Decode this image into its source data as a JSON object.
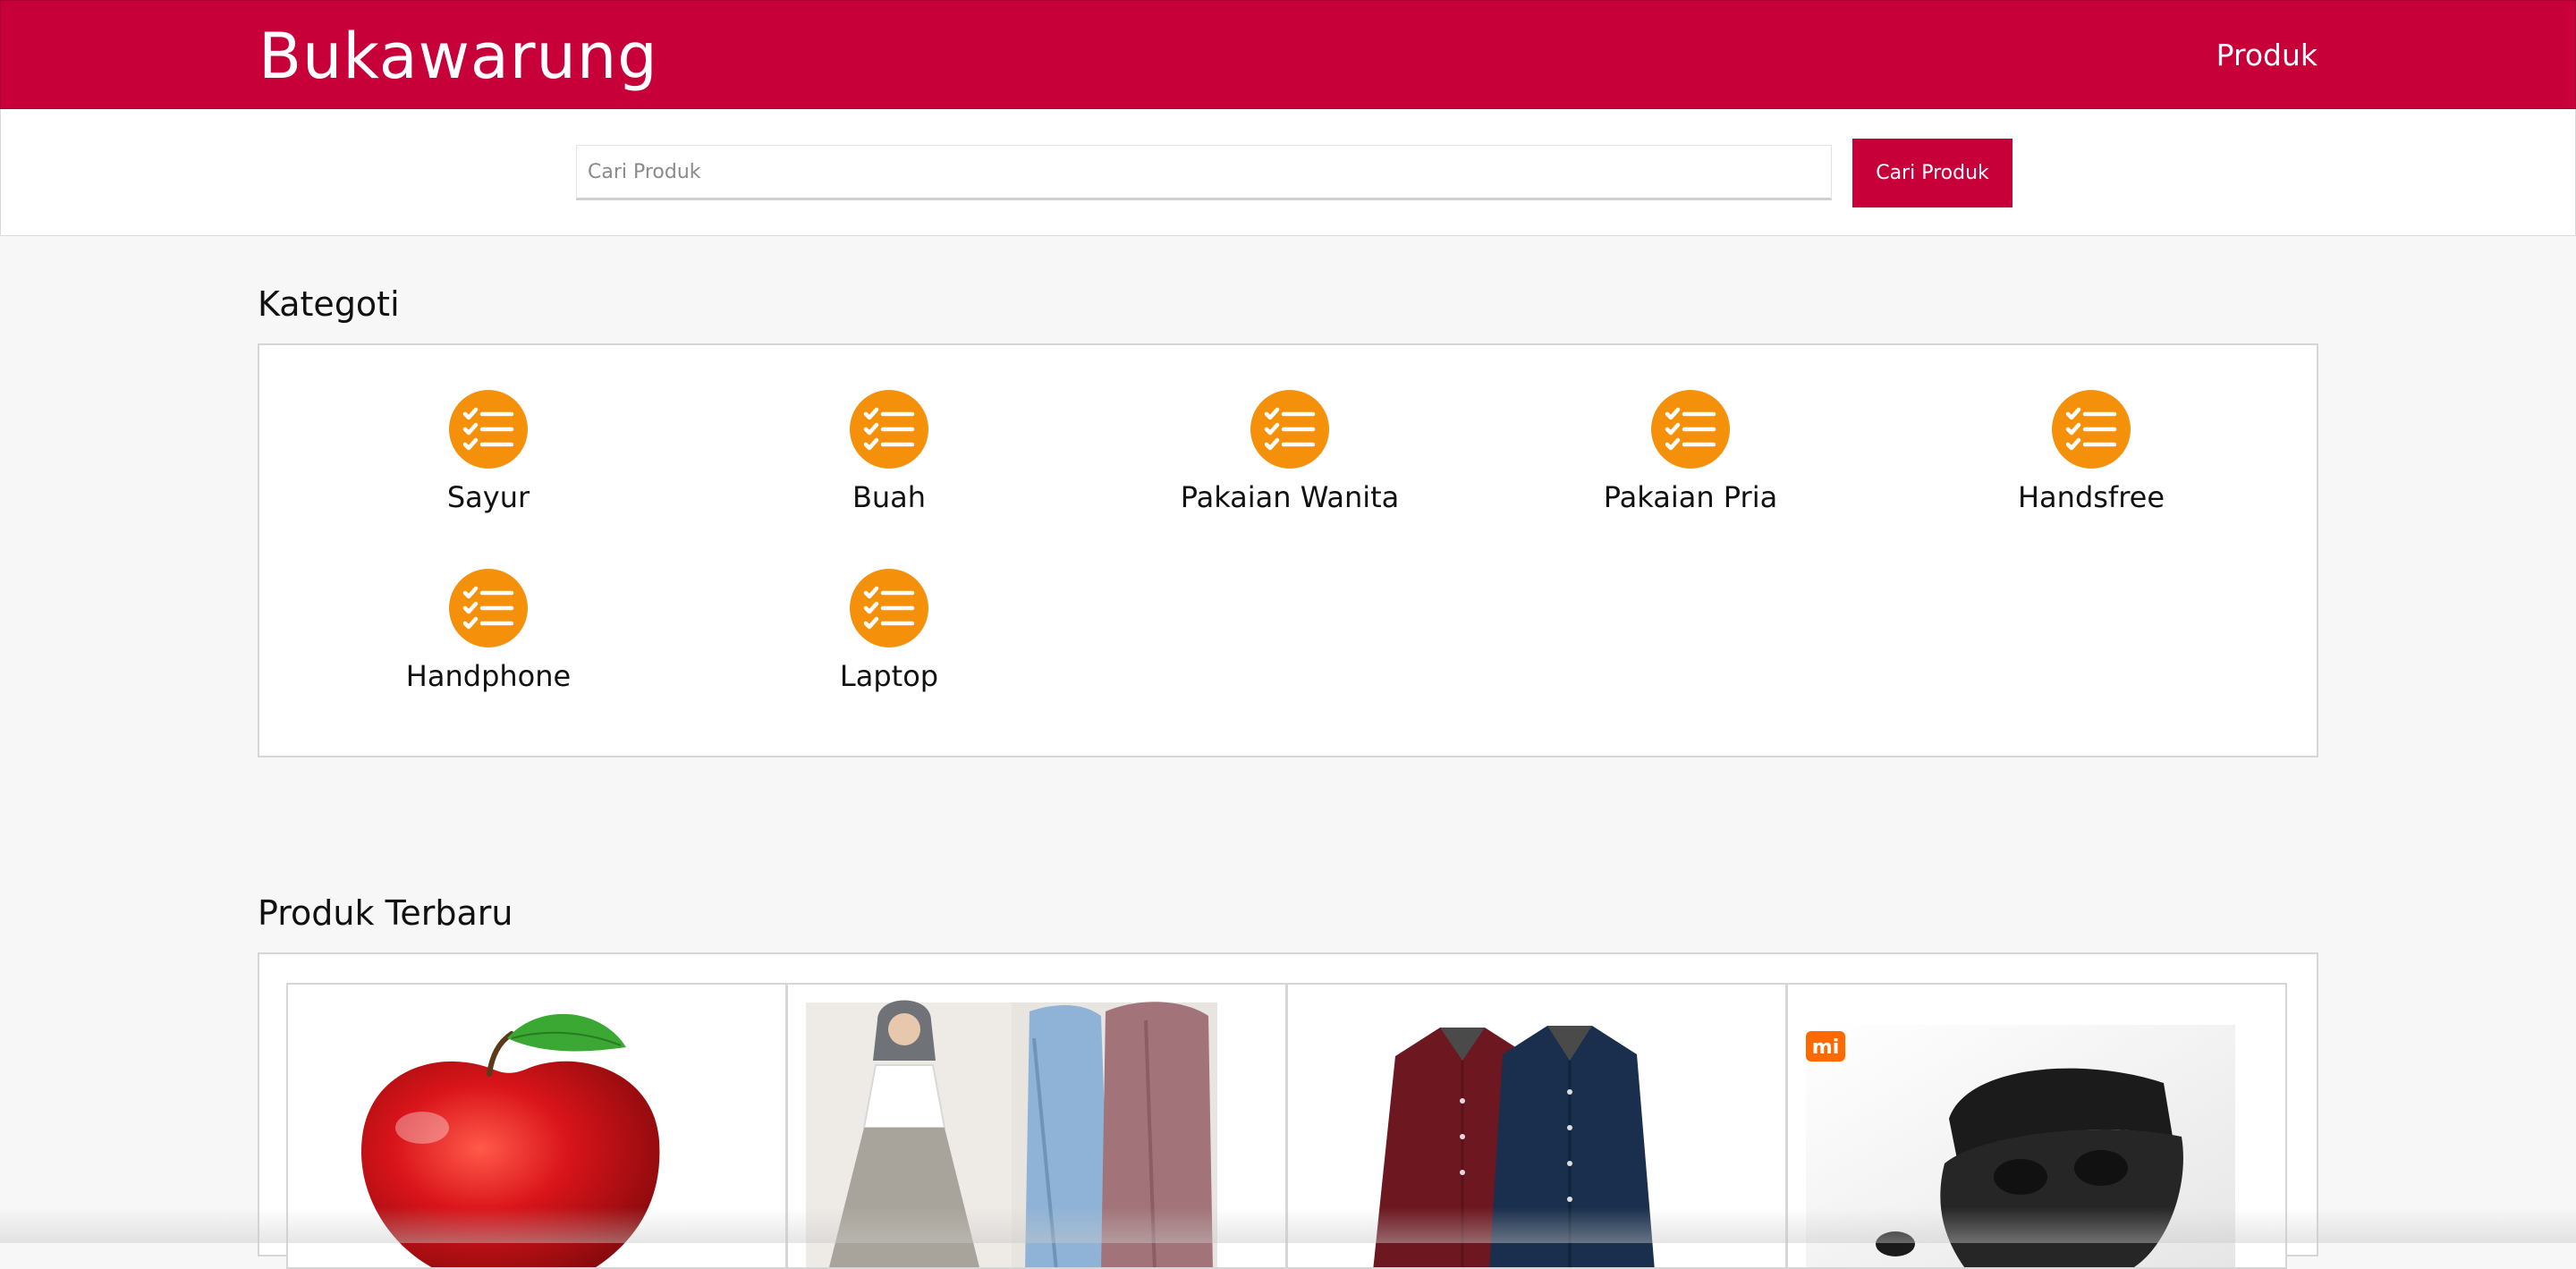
{
  "header": {
    "brand": "Bukawarung",
    "nav_link": "Produk"
  },
  "search": {
    "placeholder": "Cari Produk",
    "button_label": "Cari Produk"
  },
  "categories": {
    "title": "Kategoti",
    "items": [
      {
        "label": "Sayur",
        "icon": "checklist-icon"
      },
      {
        "label": "Buah",
        "icon": "checklist-icon"
      },
      {
        "label": "Pakaian Wanita",
        "icon": "checklist-icon"
      },
      {
        "label": "Pakaian Pria",
        "icon": "checklist-icon"
      },
      {
        "label": "Handsfree",
        "icon": "checklist-icon"
      },
      {
        "label": "Handphone",
        "icon": "checklist-icon"
      },
      {
        "label": "Laptop",
        "icon": "checklist-icon"
      }
    ]
  },
  "products": {
    "title": "Produk Terbaru",
    "items": [
      {
        "image": "apple"
      },
      {
        "image": "women-clothing"
      },
      {
        "image": "men-shirts"
      },
      {
        "image": "xiaomi-earbuds",
        "logo_text": "mi"
      }
    ]
  },
  "colors": {
    "brand": "#c8003a",
    "icon_bg": "#f5900b",
    "page_bg": "#f7f7f7"
  }
}
